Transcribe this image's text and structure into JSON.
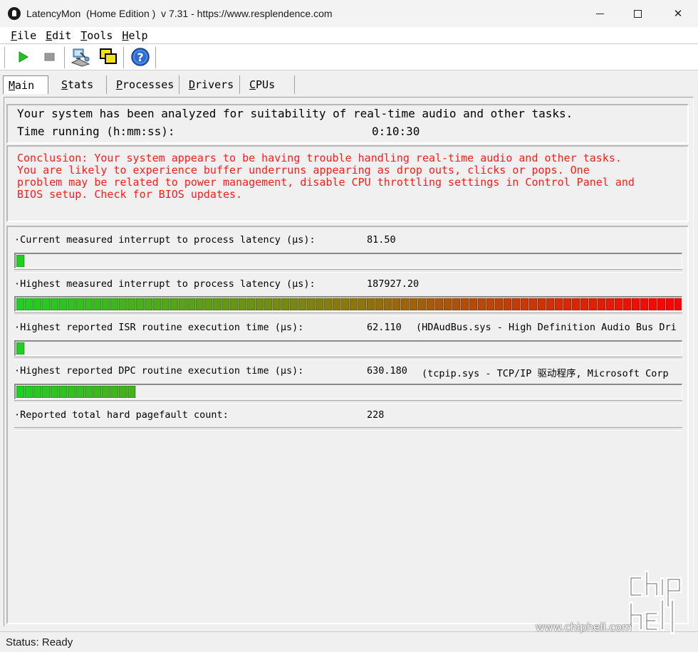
{
  "window": {
    "title": "LatencyMon  (Home Edition )  v 7.31 - https://www.resplendence.com",
    "minimize_glyph": "",
    "close_glyph": "✕"
  },
  "menu": {
    "items": [
      {
        "accel": "F",
        "rest": "ile"
      },
      {
        "accel": "E",
        "rest": "dit"
      },
      {
        "accel": "T",
        "rest": "ools"
      },
      {
        "accel": "H",
        "rest": "elp"
      }
    ]
  },
  "toolbar": {
    "icons": [
      "play-icon",
      "stop-icon",
      "pc-analyze-icon",
      "windows-icon",
      "help-icon"
    ]
  },
  "tabs": [
    {
      "accel": "M",
      "rest": "ain",
      "active": true
    },
    {
      "accel": "S",
      "rest": "tats",
      "active": false
    },
    {
      "accel": "P",
      "rest": "rocesses",
      "active": false
    },
    {
      "accel": "D",
      "rest": "rivers",
      "active": false
    },
    {
      "accel": "C",
      "rest": "PUs",
      "active": false
    }
  ],
  "summary": {
    "line1": "Your system has been analyzed for suitability of real-time audio and other tasks.",
    "line2_label": "Time running (h:mm:ss):",
    "line2_value": "0:10:30"
  },
  "conclusion": "Conclusion: Your system appears to be having trouble handling real-time audio and other tasks.\nYou are likely to experience buffer underruns appearing as drop outs, clicks or pops. One\nproblem may be related to power management, disable CPU throttling settings in Control Panel and\nBIOS setup. Check for BIOS updates.",
  "metrics": [
    {
      "label": "·Current measured interrupt to process latency (µs):",
      "value": "81.50",
      "extra": "",
      "fill_segments": 1
    },
    {
      "label": "·Highest measured interrupt to process latency (µs):",
      "value": "187927.20",
      "extra": "",
      "fill_segments": 78
    },
    {
      "label": "·Highest reported ISR routine execution time (µs):",
      "value": "62.110",
      "extra": "(HDAudBus.sys - High Definition Audio Bus Dri",
      "fill_segments": 1
    },
    {
      "label": "·Highest reported DPC routine execution time (µs):",
      "value": "630.180",
      "extra": "(tcpip.sys - TCP/IP 驱动程序, Microsoft Corp",
      "fill_segments": 14
    },
    {
      "label": "·Reported total hard pagefault count:",
      "value": "228",
      "extra": "",
      "fill_segments": 0
    }
  ],
  "status": "Status: Ready",
  "watermark": {
    "url": "www.chiphell.com",
    "logo_text": "chip hell"
  },
  "colors": {
    "conclusion_red": "#ff1a1a",
    "bar_green": "#1fd11f",
    "bar_red": "#ff0000"
  }
}
